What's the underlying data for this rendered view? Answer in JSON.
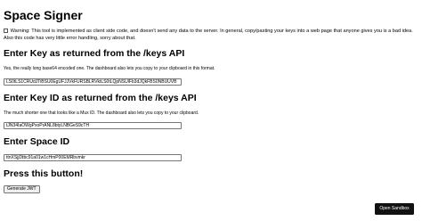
{
  "page": {
    "title": "Space Signer",
    "warning": "Warning: This tool is implemented as client side code, and doesn't send any data to the server. In general, copy/pasting your keys into a web page that anyone gives you is a bad idea. Also this code has very little error handling, sorry about that."
  },
  "key_section": {
    "heading": "Enter Key as returned from the /keys API",
    "description": "Yes, the really long base64 encoded one. The dashboard also lets you copy to your clipboard in this format.",
    "value": "LS0tLS1CRUdJTiBSU0EgUFJJVkFURSBLRVktLS0tLQpNSUlFb3dJQkFBS0NBUUVB"
  },
  "key_id_section": {
    "heading": "Enter Key ID as returned from the /keys API",
    "description": "The much shorter one that looks like a Mux ID. The dashboard also lets you copy to your clipboard.",
    "value": "tJN34IaOWgPxoPrANL8btyLNBGeS9cTH"
  },
  "space_section": {
    "heading": "Enter Space ID",
    "value": "ttnXSjjDtbc91a01w1cHmP00EMRbvmkr"
  },
  "action_section": {
    "heading": "Press this button!",
    "button_label": "Generate JWT"
  },
  "sandbox_button_label": "Open Sandbox"
}
